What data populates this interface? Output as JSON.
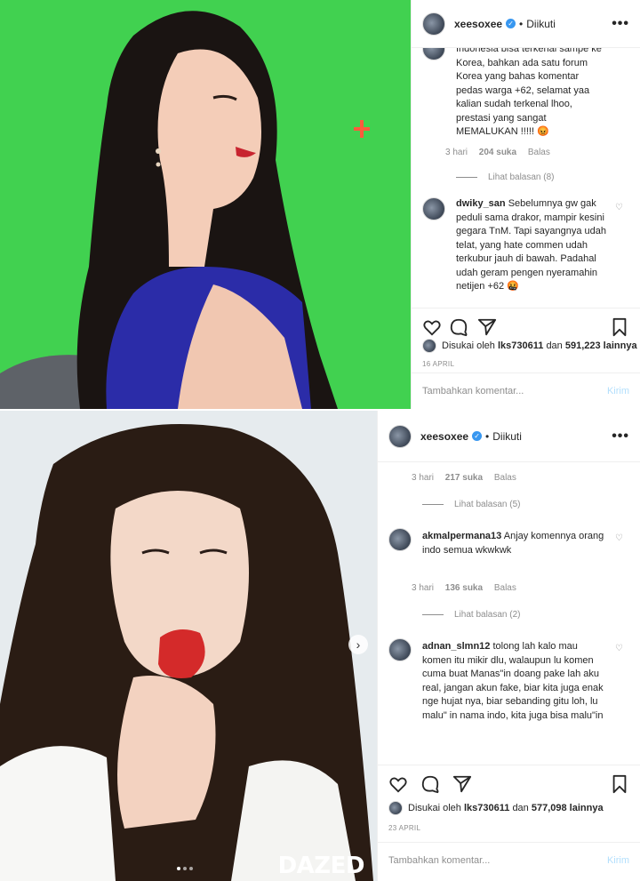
{
  "post1": {
    "username": "xeesoxee",
    "follow_label": "Diikuti",
    "more_label": "•••",
    "comment1": {
      "text": "Indonesia bisa terkenal sampe ke Korea, bahkan ada satu forum Korea yang bahas komentar pedas warga +62, selamat yaa kalian sudah terkenal lhoo, prestasi yang sangat MEMALUKAN !!!!! 😡",
      "time": "3 hari",
      "likes": "204 suka",
      "reply": "Balas",
      "view_replies": "Lihat balasan (8)"
    },
    "comment2": {
      "username": "dwiky_san",
      "text": "Sebelumnya gw gak peduli sama drakor, mampir kesini gegara TnM. Tapi sayangnya udah telat, yang hate commen udah terkubur jauh di bawah. Padahal udah geram pengen nyeramahin netijen +62 🤬"
    },
    "liked_by_prefix": "Disukai oleh",
    "liked_by_user": "lks730611",
    "liked_by_and": "dan",
    "liked_count": "591,223 lainnya",
    "date": "16 APRIL",
    "add_comment_placeholder": "Tambahkan komentar...",
    "send_label": "Kirim"
  },
  "post2": {
    "username": "xeesoxee",
    "follow_label": "Diikuti",
    "more_label": "•••",
    "top_meta": {
      "time": "3 hari",
      "likes": "217 suka",
      "reply": "Balas",
      "view_replies": "Lihat balasan (5)"
    },
    "comment1": {
      "username": "akmalpermana13",
      "text": "Anjay komennya orang indo semua wkwkwk",
      "time": "3 hari",
      "likes": "136 suka",
      "reply": "Balas",
      "view_replies": "Lihat balasan (2)"
    },
    "comment2": {
      "username": "adnan_slmn12",
      "text": "tolong lah kalo mau komen itu mikir dlu, walaupun lu komen cuma buat Manas\"in doang pake lah aku real, jangan akun fake, biar kita juga enak nge hujat nya, biar sebanding gitu loh, lu malu\" in nama indo, kita juga bisa malu\"in"
    },
    "liked_by_prefix": "Disukai oleh",
    "liked_by_user": "lks730611",
    "liked_by_and": "dan",
    "liked_count": "577,098 lainnya",
    "date": "23 APRIL",
    "add_comment_placeholder": "Tambahkan komentar...",
    "send_label": "Kirim",
    "watermark": "DAZED"
  },
  "colors": {
    "green_screen": "#3fd24f",
    "verified": "#3897f0",
    "send_disabled": "#b2dffc"
  }
}
